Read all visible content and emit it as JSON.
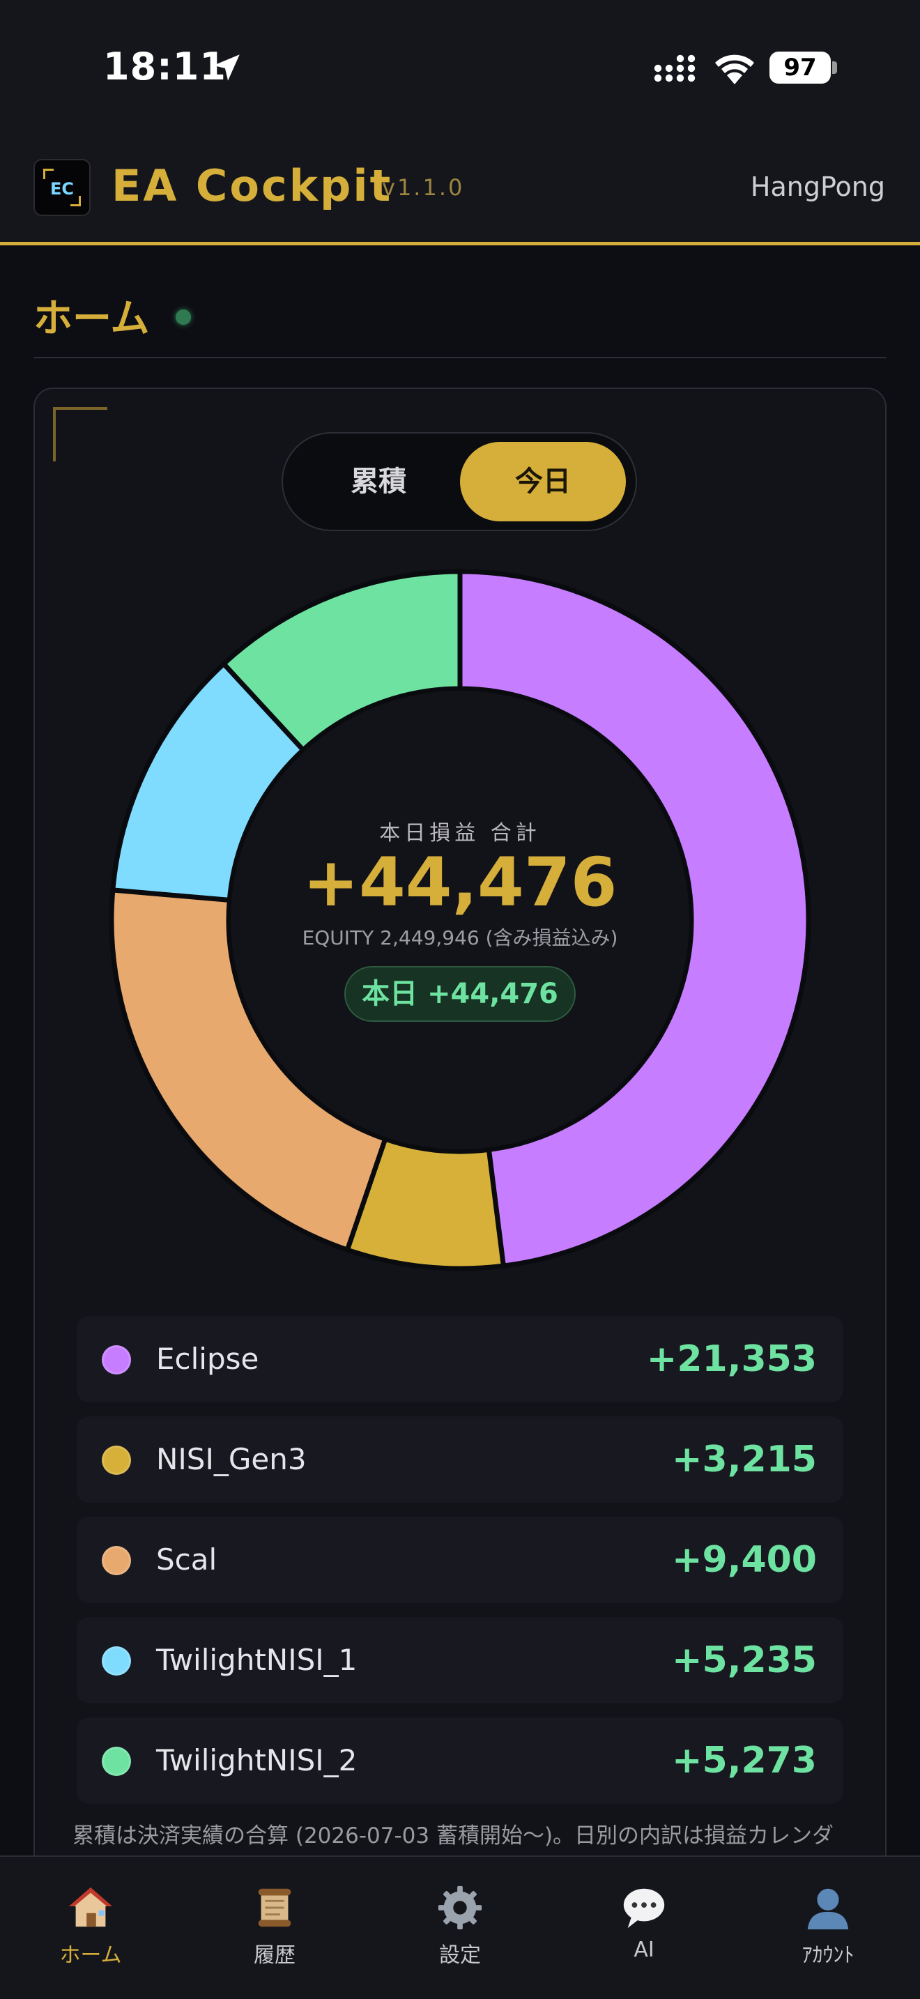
{
  "status_bar": {
    "time": "18:11",
    "battery": "97"
  },
  "header": {
    "logo_text": "EC",
    "title": "EA Cockpit",
    "version": "v1.1.0",
    "user": "HangPong"
  },
  "page": {
    "title": "ホーム"
  },
  "toggle": {
    "cumulative_label": "累積",
    "today_label": "今日",
    "selected": "今日"
  },
  "summary": {
    "label": "本日損益 合計",
    "total": "+44,476",
    "equity": "EQUITY 2,449,946 (含み損益込み)",
    "today_badge": "本日 +44,476"
  },
  "chart_data": {
    "type": "pie",
    "categories": [
      "Eclipse",
      "NISI_Gen3",
      "Scal",
      "TwilightNISI_1",
      "TwilightNISI_2"
    ],
    "values": [
      21353,
      3215,
      9400,
      5235,
      5273
    ],
    "colors": [
      "#c77dff",
      "#d6b038",
      "#e8a96e",
      "#7fdcff",
      "#6ee3a1"
    ]
  },
  "legend": [
    {
      "name": "Eclipse",
      "value": "+21,353",
      "color": "#c77dff"
    },
    {
      "name": "NISI_Gen3",
      "value": "+3,215",
      "color": "#d6b038"
    },
    {
      "name": "Scal",
      "value": "+9,400",
      "color": "#e8a96e"
    },
    {
      "name": "TwilightNISI_1",
      "value": "+5,235",
      "color": "#7fdcff"
    },
    {
      "name": "TwilightNISI_2",
      "value": "+5,273",
      "color": "#6ee3a1"
    }
  ],
  "footnote": "累積は決済実績の合算 (2026-07-03 蓄積開始〜)。日別の内訳は損益カレンダ",
  "tabs": [
    {
      "label": "ホーム",
      "icon": "house-icon"
    },
    {
      "label": "履歴",
      "icon": "scroll-icon"
    },
    {
      "label": "設定",
      "icon": "gear-icon"
    },
    {
      "label": "AI",
      "icon": "speech-bubble-icon"
    },
    {
      "label": "ｱｶｳﾝﾄ",
      "icon": "person-icon"
    }
  ]
}
